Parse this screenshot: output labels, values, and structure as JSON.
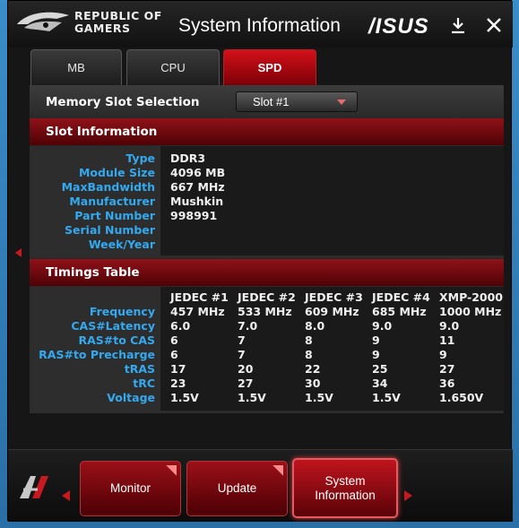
{
  "titlebar": {
    "brand_line1": "REPUBLIC OF",
    "brand_line2": "GAMERS",
    "title": "System Information",
    "vendor_logo_text": "/ISUS",
    "download_icon": "download-icon",
    "close_icon": "close-icon"
  },
  "tabs": [
    {
      "label": "MB",
      "active": false
    },
    {
      "label": "CPU",
      "active": false
    },
    {
      "label": "SPD",
      "active": true
    }
  ],
  "memory_slot": {
    "label": "Memory Slot Selection",
    "selected": "Slot #1"
  },
  "slot_info": {
    "header": "Slot Information",
    "rows": [
      {
        "label": "Type",
        "value": "DDR3"
      },
      {
        "label": "Module Size",
        "value": "4096 MB"
      },
      {
        "label": "MaxBandwidth",
        "value": "667 MHz"
      },
      {
        "label": "Manufacturer",
        "value": "Mushkin"
      },
      {
        "label": "Part Number",
        "value": "998991"
      },
      {
        "label": "Serial Number",
        "value": ""
      },
      {
        "label": "Week/Year",
        "value": ""
      }
    ]
  },
  "timings": {
    "header": "Timings Table",
    "columns": [
      "JEDEC #1",
      "JEDEC #2",
      "JEDEC #3",
      "JEDEC #4",
      "XMP-2000"
    ],
    "rows": [
      {
        "label": "Frequency",
        "values": [
          "457 MHz",
          "533 MHz",
          "609 MHz",
          "685 MHz",
          "1000 MHz"
        ]
      },
      {
        "label": "CAS#Latency",
        "values": [
          "6.0",
          "7.0",
          "8.0",
          "9.0",
          "9.0"
        ]
      },
      {
        "label": "RAS#to CAS",
        "values": [
          "6",
          "7",
          "8",
          "9",
          "11"
        ]
      },
      {
        "label": "RAS#to Precharge",
        "values": [
          "6",
          "7",
          "8",
          "9",
          "9"
        ]
      },
      {
        "label": "tRAS",
        "values": [
          "17",
          "20",
          "22",
          "25",
          "27"
        ]
      },
      {
        "label": "tRC",
        "values": [
          "23",
          "27",
          "30",
          "34",
          "36"
        ]
      },
      {
        "label": "Voltage",
        "values": [
          "1.5V",
          "1.5V",
          "1.5V",
          "1.5V",
          "1.650V"
        ]
      }
    ]
  },
  "bottom_nav": {
    "monitor": "Monitor",
    "update": "Update",
    "sysinfo_line1": "System",
    "sysinfo_line2": "Information"
  },
  "colors": {
    "accent_red": "#c81920",
    "label_blue": "#33a9f0"
  }
}
